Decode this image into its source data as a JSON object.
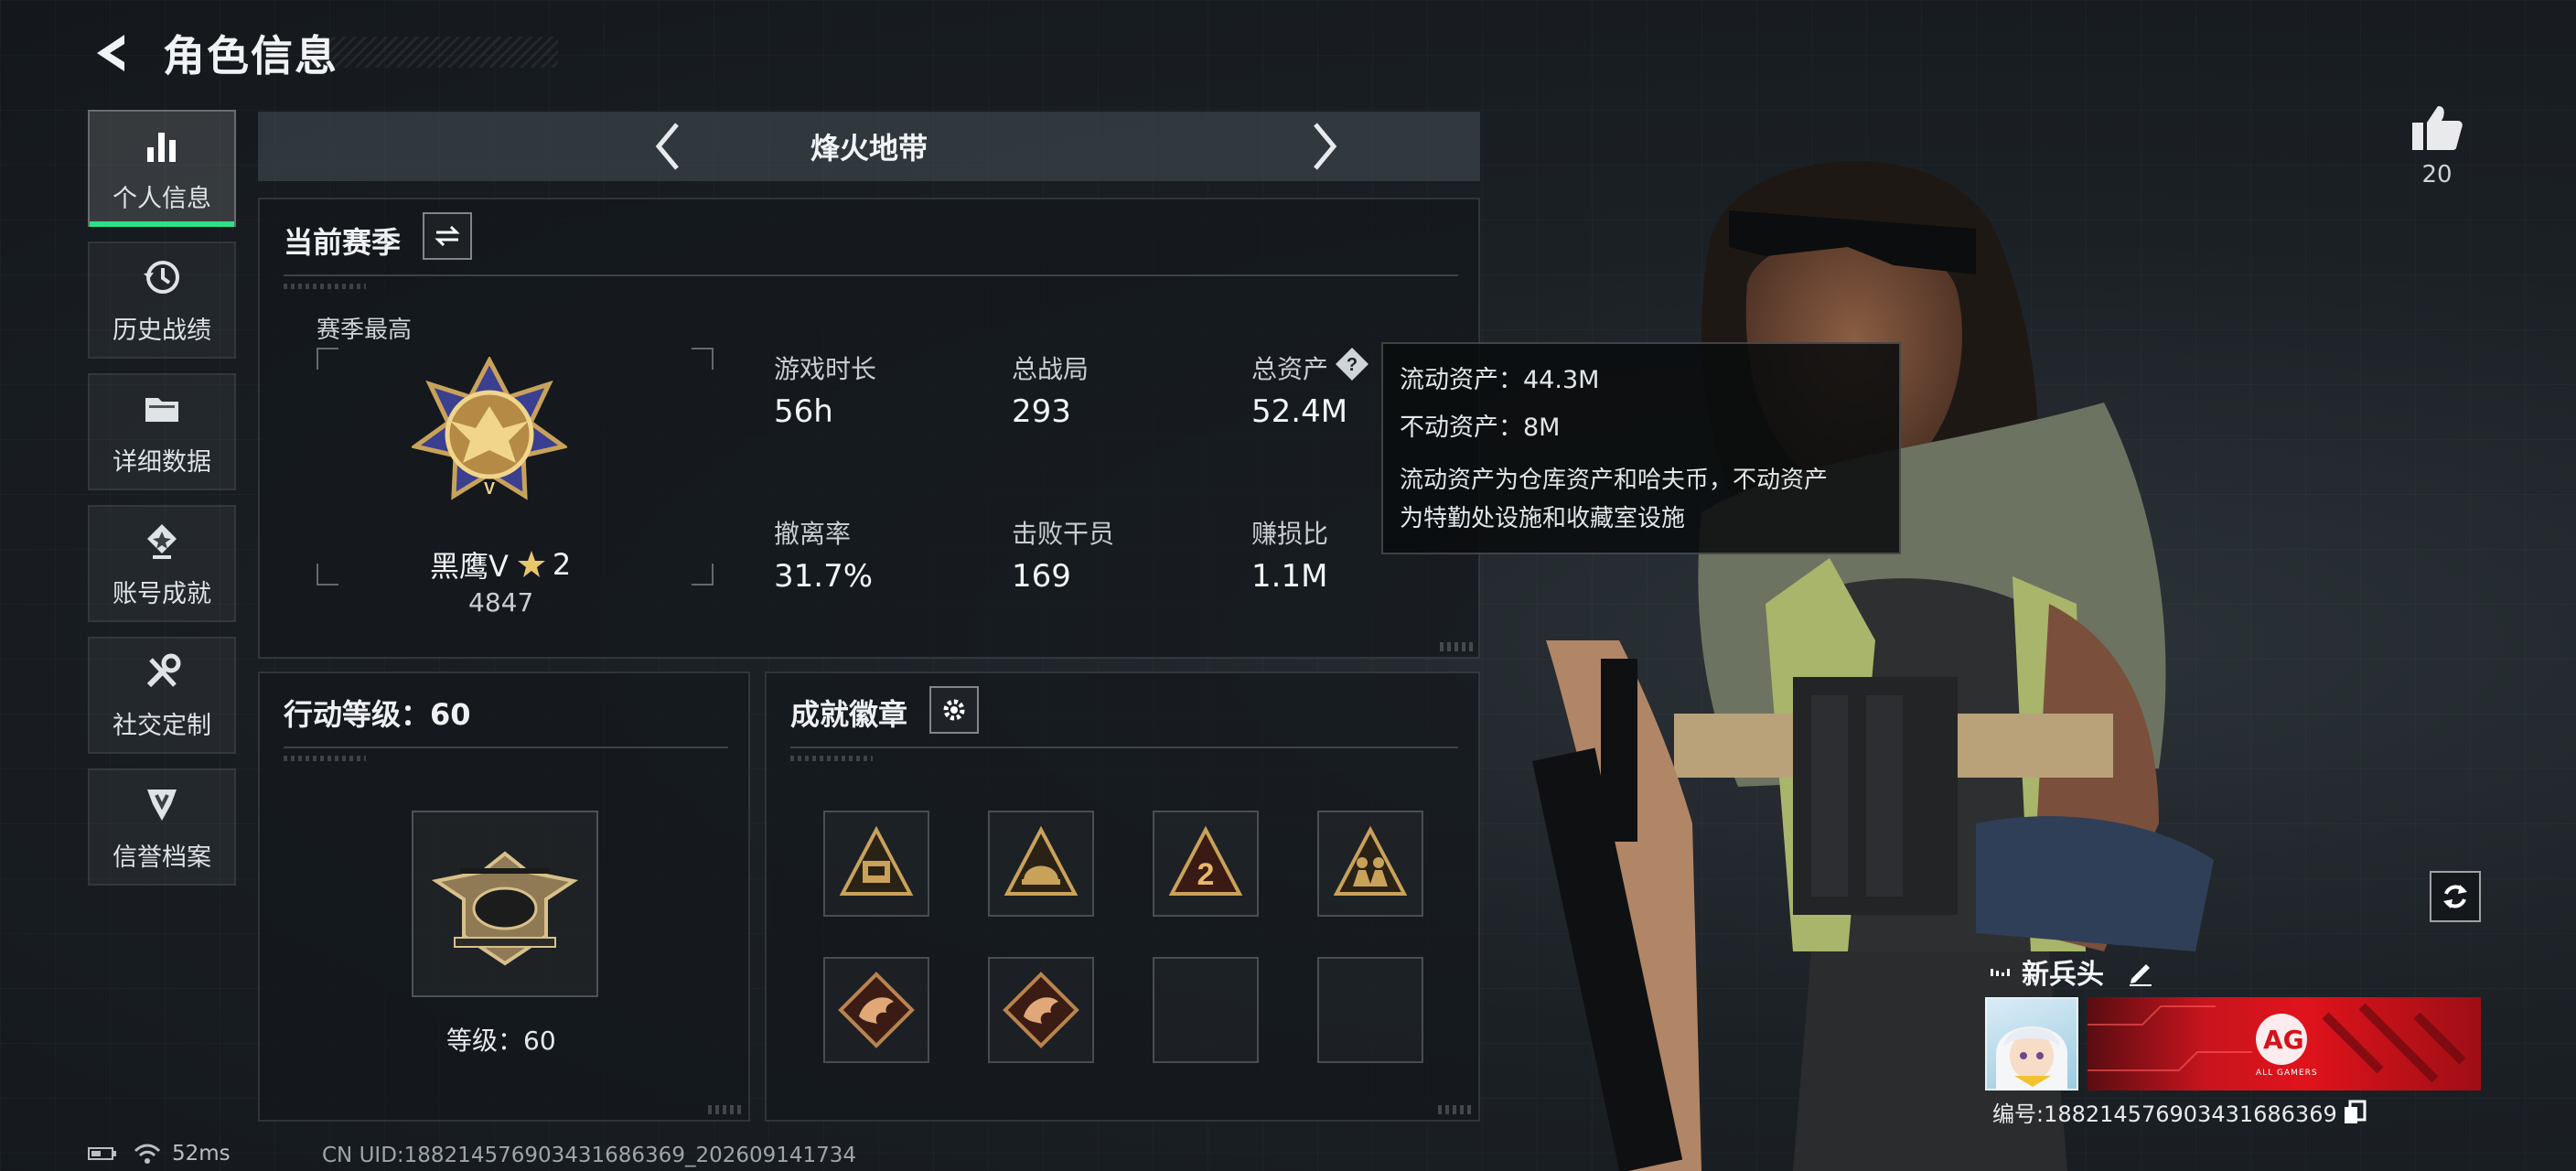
{
  "header": {
    "title": "角色信息"
  },
  "sidebar": {
    "items": [
      {
        "label": "个人信息",
        "icon": "bar-chart-icon",
        "active": true
      },
      {
        "label": "历史战绩",
        "icon": "history-clock-icon",
        "active": false
      },
      {
        "label": "详细数据",
        "icon": "folder-icon",
        "active": false
      },
      {
        "label": "账号成就",
        "icon": "achievement-icon",
        "active": false
      },
      {
        "label": "社交定制",
        "icon": "wrench-screwdriver-icon",
        "active": false
      },
      {
        "label": "信誉档案",
        "icon": "reputation-shield-icon",
        "active": false
      }
    ]
  },
  "mode": {
    "title": "烽火地带"
  },
  "season": {
    "title": "当前赛季",
    "high_label": "赛季最高",
    "rank_name": "黑鹰V",
    "rank_stars": "2",
    "rank_score": "4847",
    "stats": [
      {
        "label": "游戏时长",
        "value": "56h"
      },
      {
        "label": "总战局",
        "value": "293"
      },
      {
        "label": "总资产",
        "value": "52.4M"
      },
      {
        "label": "撤离率",
        "value": "31.7%"
      },
      {
        "label": "击败干员",
        "value": "169"
      },
      {
        "label": "赚损比",
        "value": "1.1M"
      }
    ]
  },
  "tooltip": {
    "liquid": "流动资产：44.3M",
    "fixed": "不动资产：8M",
    "desc_line1": "流动资产为仓库资产和哈夫币，不动资产",
    "desc_line2": "为特勤处设施和收藏室设施"
  },
  "action_level": {
    "title": "行动等级：60",
    "level_text": "等级：60"
  },
  "badges": {
    "title": "成就徽章",
    "slots": [
      {
        "icon": "badge-outpost-icon",
        "filled": true
      },
      {
        "icon": "badge-helmet-icon",
        "filled": true
      },
      {
        "icon": "badge-number-2-icon",
        "filled": true
      },
      {
        "icon": "badge-soldiers-icon",
        "filled": true
      },
      {
        "icon": "badge-dragon-icon",
        "filled": true
      },
      {
        "icon": "badge-dragon-icon",
        "filled": true
      },
      {
        "icon": "empty-slot",
        "filled": false
      },
      {
        "icon": "empty-slot",
        "filled": false
      }
    ]
  },
  "like": {
    "count": "20"
  },
  "player": {
    "name": "新兵头",
    "id_text": "编号:1882145769034316863​69",
    "banner_text": "AG",
    "banner_sub": "ALL GAMERS"
  },
  "status": {
    "ping": "52ms",
    "uid": "CN UID:18821457690343168636​9_202609141734"
  },
  "colors": {
    "accent_green": "#2ee08a",
    "badge_gold": "#c9a25a",
    "banner_red": "#e0131c"
  }
}
